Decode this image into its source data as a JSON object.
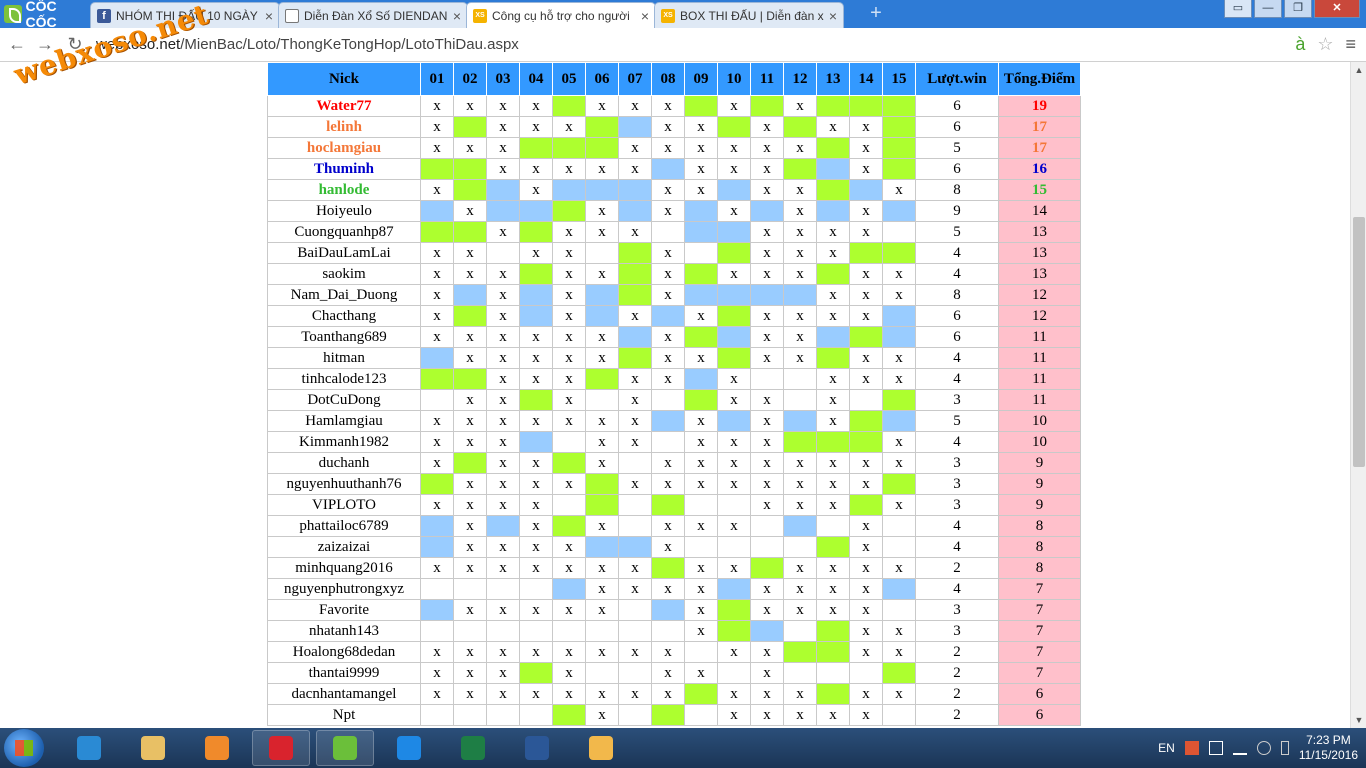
{
  "browser": {
    "brand": "CỐC CỐC",
    "tabs": [
      {
        "label": "NHÓM THI ĐẤU 10 NGÀY",
        "icon": "facebook-icon"
      },
      {
        "label": "Diễn Đàn Xổ Số DIENDAN",
        "icon": "document-icon"
      },
      {
        "label": "Công cụ hỗ trợ cho người",
        "icon": "xs-icon",
        "active": true
      },
      {
        "label": "BOX THI ĐẤU | Diễn đàn x",
        "icon": "xs-icon"
      }
    ],
    "url_host": "webxoso.net",
    "url_path": "/MienBac/Loto/ThongKeTongHop/LotoThiDau.aspx",
    "win_controls": {
      "minimize": "—",
      "maximize": "❐",
      "close": "✕"
    },
    "nav": {
      "back": "←",
      "forward": "→",
      "reload": "↻"
    }
  },
  "watermark": "webxoso.net",
  "table": {
    "headers": [
      "Nick",
      "01",
      "02",
      "03",
      "04",
      "05",
      "06",
      "07",
      "08",
      "09",
      "10",
      "11",
      "12",
      "13",
      "14",
      "15",
      "Lượt.win",
      "Tổng.Điểm"
    ],
    "rows": [
      {
        "nick": "Water77",
        "color": "#ff0000",
        "cells": [
          "x",
          "x",
          "x",
          "x",
          "G",
          "x",
          "x",
          "x",
          "G",
          "x",
          "G",
          "x",
          "G",
          "G",
          "G"
        ],
        "wins": "6",
        "points": "19"
      },
      {
        "nick": "lelinh",
        "color": "#f47738",
        "cells": [
          "x",
          "G",
          "x",
          "x",
          "x",
          "G",
          "B",
          "x",
          "x",
          "G",
          "x",
          "G",
          "x",
          "x",
          "G"
        ],
        "wins": "6",
        "points": "17"
      },
      {
        "nick": "hoclamgiau",
        "color": "#f47738",
        "cells": [
          "x",
          "x",
          "x",
          "G",
          "G",
          "G",
          "x",
          "x",
          "x",
          "x",
          "x",
          "x",
          "G",
          "x",
          "G"
        ],
        "wins": "5",
        "points": "17"
      },
      {
        "nick": "Thuminh",
        "color": "#0000cc",
        "cells": [
          "G",
          "G",
          "x",
          "x",
          "x",
          "x",
          "x",
          "B",
          "x",
          "x",
          "x",
          "G",
          "B",
          "x",
          "G"
        ],
        "wins": "6",
        "points": "16"
      },
      {
        "nick": "hanlode",
        "color": "#33bb33",
        "cells": [
          "x",
          "G",
          "B",
          "x",
          "B",
          "B",
          "B",
          "x",
          "x",
          "B",
          "x",
          "x",
          "G",
          "B",
          "x"
        ],
        "wins": "8",
        "points": "15"
      },
      {
        "nick": "Hoiyeulo",
        "color": "",
        "cells": [
          "B",
          "x",
          "B",
          "B",
          "G",
          "x",
          "B",
          "x",
          "B",
          "x",
          "B",
          "x",
          "B",
          "x",
          "B"
        ],
        "wins": "9",
        "points": "14"
      },
      {
        "nick": "Cuongquanhp87",
        "color": "",
        "cells": [
          "G",
          "G",
          "x",
          "G",
          "x",
          "x",
          "x",
          "",
          "B",
          "B",
          "x",
          "x",
          "x",
          "x",
          ""
        ],
        "wins": "5",
        "points": "13"
      },
      {
        "nick": "BaiDauLamLai",
        "color": "",
        "cells": [
          "x",
          "x",
          "",
          "x",
          "x",
          "",
          "G",
          "x",
          "",
          "G",
          "x",
          "x",
          "x",
          "G",
          "G"
        ],
        "wins": "4",
        "points": "13"
      },
      {
        "nick": "saokim",
        "color": "",
        "cells": [
          "x",
          "x",
          "x",
          "G",
          "x",
          "x",
          "G",
          "x",
          "G",
          "x",
          "x",
          "x",
          "G",
          "x",
          "x"
        ],
        "wins": "4",
        "points": "13"
      },
      {
        "nick": "Nam_Dai_Duong",
        "color": "",
        "cells": [
          "x",
          "B",
          "x",
          "B",
          "x",
          "B",
          "G",
          "x",
          "B",
          "B",
          "B",
          "B",
          "x",
          "x",
          "x"
        ],
        "wins": "8",
        "points": "12"
      },
      {
        "nick": "Chacthang",
        "color": "",
        "cells": [
          "x",
          "G",
          "x",
          "B",
          "x",
          "B",
          "x",
          "B",
          "x",
          "G",
          "x",
          "x",
          "x",
          "x",
          "B"
        ],
        "wins": "6",
        "points": "12"
      },
      {
        "nick": "Toanthang689",
        "color": "",
        "cells": [
          "x",
          "x",
          "x",
          "x",
          "x",
          "x",
          "B",
          "x",
          "G",
          "B",
          "x",
          "x",
          "B",
          "G",
          "B"
        ],
        "wins": "6",
        "points": "11"
      },
      {
        "nick": "hitman",
        "color": "",
        "cells": [
          "B",
          "x",
          "x",
          "x",
          "x",
          "x",
          "G",
          "x",
          "x",
          "G",
          "x",
          "x",
          "G",
          "x",
          "x"
        ],
        "wins": "4",
        "points": "11"
      },
      {
        "nick": "tinhcalode123",
        "color": "",
        "cells": [
          "G",
          "G",
          "x",
          "x",
          "x",
          "G",
          "x",
          "x",
          "B",
          "x",
          "",
          "",
          "x",
          "x",
          "x"
        ],
        "wins": "4",
        "points": "11"
      },
      {
        "nick": "DotCuDong",
        "color": "",
        "cells": [
          "",
          "x",
          "x",
          "G",
          "x",
          "",
          "x",
          "",
          "G",
          "x",
          "x",
          "",
          "x",
          "",
          "G"
        ],
        "wins": "3",
        "points": "11"
      },
      {
        "nick": "Hamlamgiau",
        "color": "",
        "cells": [
          "x",
          "x",
          "x",
          "x",
          "x",
          "x",
          "x",
          "B",
          "x",
          "B",
          "x",
          "B",
          "x",
          "G",
          "B"
        ],
        "wins": "5",
        "points": "10"
      },
      {
        "nick": "Kimmanh1982",
        "color": "",
        "cells": [
          "x",
          "x",
          "x",
          "B",
          "",
          "x",
          "x",
          "",
          "x",
          "x",
          "x",
          "G",
          "G",
          "G",
          "x"
        ],
        "wins": "4",
        "points": "10"
      },
      {
        "nick": "duchanh",
        "color": "",
        "cells": [
          "x",
          "G",
          "x",
          "x",
          "G",
          "x",
          "",
          "x",
          "x",
          "x",
          "x",
          "x",
          "x",
          "x",
          "x"
        ],
        "wins": "3",
        "points": "9"
      },
      {
        "nick": "nguyenhuuthanh76",
        "color": "",
        "cells": [
          "G",
          "x",
          "x",
          "x",
          "x",
          "G",
          "x",
          "x",
          "x",
          "x",
          "x",
          "x",
          "x",
          "x",
          "G"
        ],
        "wins": "3",
        "points": "9"
      },
      {
        "nick": "VIPLOTO",
        "color": "",
        "cells": [
          "x",
          "x",
          "x",
          "x",
          "",
          "G",
          "",
          "G",
          "",
          "",
          "x",
          "x",
          "x",
          "G",
          "x"
        ],
        "wins": "3",
        "points": "9"
      },
      {
        "nick": "phattailoc6789",
        "color": "",
        "cells": [
          "B",
          "x",
          "B",
          "x",
          "G",
          "x",
          "",
          "x",
          "x",
          "x",
          "",
          "B",
          "",
          "x",
          ""
        ],
        "wins": "4",
        "points": "8"
      },
      {
        "nick": "zaizaizai",
        "color": "",
        "cells": [
          "B",
          "x",
          "x",
          "x",
          "x",
          "B",
          "B",
          "x",
          "",
          "",
          "",
          "",
          "G",
          "x",
          ""
        ],
        "wins": "4",
        "points": "8"
      },
      {
        "nick": "minhquang2016",
        "color": "",
        "cells": [
          "x",
          "x",
          "x",
          "x",
          "x",
          "x",
          "x",
          "G",
          "x",
          "x",
          "G",
          "x",
          "x",
          "x",
          "x"
        ],
        "wins": "2",
        "points": "8"
      },
      {
        "nick": "nguyenphutrongxyz",
        "color": "",
        "cells": [
          "",
          "",
          "",
          "",
          "B",
          "x",
          "x",
          "x",
          "x",
          "B",
          "x",
          "x",
          "x",
          "x",
          "B"
        ],
        "wins": "4",
        "points": "7"
      },
      {
        "nick": "Favorite",
        "color": "",
        "cells": [
          "B",
          "x",
          "x",
          "x",
          "x",
          "x",
          "",
          "B",
          "x",
          "G",
          "x",
          "x",
          "x",
          "x",
          ""
        ],
        "wins": "3",
        "points": "7"
      },
      {
        "nick": "nhatanh143",
        "color": "",
        "cells": [
          "",
          "",
          "",
          "",
          "",
          "",
          "",
          "",
          "x",
          "G",
          "B",
          "",
          "G",
          "x",
          "x"
        ],
        "wins": "3",
        "points": "7"
      },
      {
        "nick": "Hoalong68dedan",
        "color": "",
        "cells": [
          "x",
          "x",
          "x",
          "x",
          "x",
          "x",
          "x",
          "x",
          "",
          "x",
          "x",
          "G",
          "G",
          "x",
          "x"
        ],
        "wins": "2",
        "points": "7"
      },
      {
        "nick": "thantai9999",
        "color": "",
        "cells": [
          "x",
          "x",
          "x",
          "G",
          "x",
          "",
          "",
          "x",
          "x",
          "",
          "x",
          "",
          "",
          "",
          "G"
        ],
        "wins": "2",
        "points": "7"
      },
      {
        "nick": "dacnhantamangel",
        "color": "",
        "cells": [
          "x",
          "x",
          "x",
          "x",
          "x",
          "x",
          "x",
          "x",
          "G",
          "x",
          "x",
          "x",
          "G",
          "x",
          "x"
        ],
        "wins": "2",
        "points": "6"
      },
      {
        "nick": "Npt",
        "color": "",
        "cells": [
          "",
          "",
          "",
          "",
          "G",
          "x",
          "",
          "G",
          "",
          "x",
          "x",
          "x",
          "x",
          "x",
          ""
        ],
        "wins": "2",
        "points": "6"
      }
    ]
  },
  "taskbar": {
    "apps": [
      {
        "name": "ie-icon",
        "color": "#2a8ad4"
      },
      {
        "name": "explorer-icon",
        "color": "#e8c065"
      },
      {
        "name": "media-player-icon",
        "color": "#f08a2b"
      },
      {
        "name": "opera-icon",
        "color": "#d9232d"
      },
      {
        "name": "coccoc-icon",
        "color": "#6bbf3a"
      },
      {
        "name": "zalo-icon",
        "color": "#1e88e5"
      },
      {
        "name": "excel-icon",
        "color": "#1e7e45"
      },
      {
        "name": "word-icon",
        "color": "#2b5797"
      },
      {
        "name": "paint-icon",
        "color": "#f2b84b"
      }
    ],
    "lang": "EN",
    "time": "7:23 PM",
    "date": "11/15/2016"
  },
  "colors": {
    "header": "#3399ff",
    "green": "#adff2f",
    "blue": "#99ccff",
    "points_bg": "#ffc0cb"
  }
}
